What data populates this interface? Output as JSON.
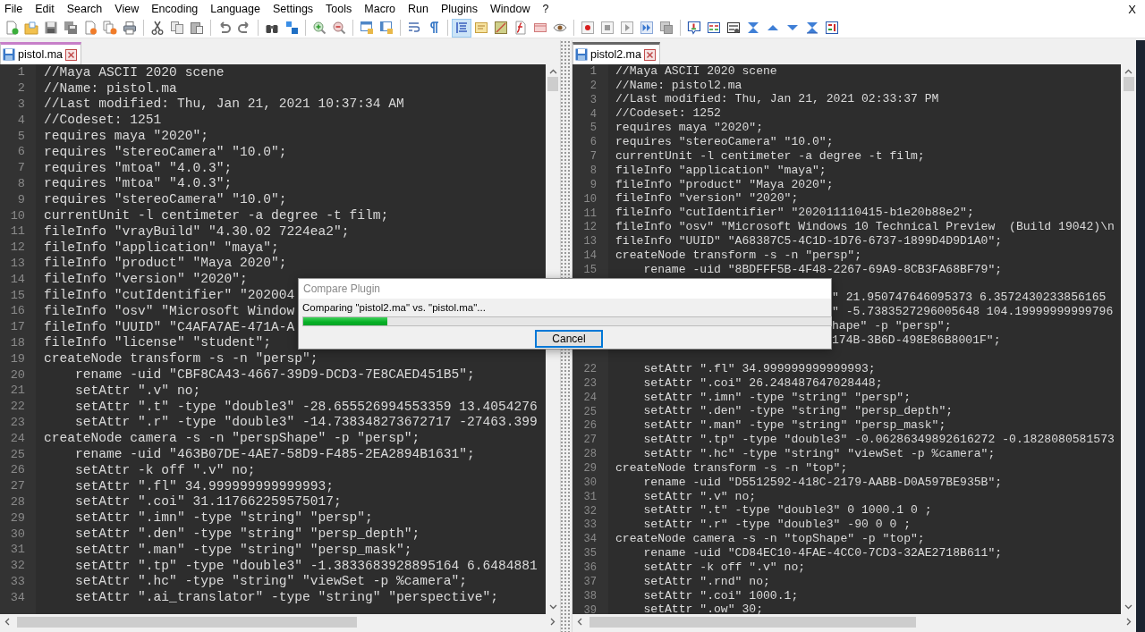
{
  "menu": [
    "File",
    "Edit",
    "Search",
    "View",
    "Encoding",
    "Language",
    "Settings",
    "Tools",
    "Macro",
    "Run",
    "Plugins",
    "Window",
    "?"
  ],
  "close_label": "X",
  "toolbar": [
    [
      {
        "kind": "new",
        "selected": false
      },
      {
        "kind": "open",
        "selected": false
      },
      {
        "kind": "save",
        "selected": false
      },
      {
        "kind": "save_all",
        "selected": false
      },
      {
        "kind": "close",
        "selected": false
      },
      {
        "kind": "close_all",
        "selected": false
      },
      {
        "kind": "print",
        "selected": false
      }
    ],
    [
      {
        "kind": "cut",
        "selected": false
      },
      {
        "kind": "copy",
        "selected": false
      },
      {
        "kind": "paste",
        "selected": false
      }
    ],
    [
      {
        "kind": "undo",
        "selected": false
      },
      {
        "kind": "redo",
        "selected": false
      }
    ],
    [
      {
        "kind": "find",
        "selected": false
      },
      {
        "kind": "replace",
        "selected": false
      }
    ],
    [
      {
        "kind": "zoom_in",
        "selected": false
      },
      {
        "kind": "zoom_out",
        "selected": false
      }
    ],
    [
      {
        "kind": "sync_v",
        "selected": false
      },
      {
        "kind": "sync_h",
        "selected": false
      }
    ],
    [
      {
        "kind": "wrap",
        "selected": false
      },
      {
        "kind": "all_chars",
        "selected": false
      }
    ],
    [
      {
        "kind": "indent_guide",
        "selected": true
      },
      {
        "kind": "note",
        "selected": false
      },
      {
        "kind": "map",
        "selected": false
      },
      {
        "kind": "function_list",
        "selected": false
      },
      {
        "kind": "panel",
        "selected": false
      },
      {
        "kind": "eye",
        "selected": false
      }
    ],
    [
      {
        "kind": "record",
        "selected": false
      },
      {
        "kind": "stop",
        "selected": false
      },
      {
        "kind": "play",
        "selected": false
      },
      {
        "kind": "play_multi",
        "selected": false
      },
      {
        "kind": "save_macro",
        "selected": false
      }
    ],
    [
      {
        "kind": "compare",
        "selected": false
      },
      {
        "kind": "compare_list",
        "selected": false
      },
      {
        "kind": "clear_compare",
        "selected": false
      },
      {
        "kind": "first",
        "selected": false
      },
      {
        "kind": "prev",
        "selected": false
      },
      {
        "kind": "next",
        "selected": false
      },
      {
        "kind": "last",
        "selected": false
      },
      {
        "kind": "nav_bar",
        "selected": false
      }
    ]
  ],
  "panes": [
    {
      "tab": {
        "label": "pistol.ma",
        "focused": true
      },
      "lines": [
        {
          "number": "1",
          "text": "//Maya ASCII 2020 scene"
        },
        {
          "number": "2",
          "text": "//Name: pistol.ma"
        },
        {
          "number": "3",
          "text": "//Last modified: Thu, Jan 21, 2021 10:37:34 AM"
        },
        {
          "number": "4",
          "text": "//Codeset: 1251"
        },
        {
          "number": "5",
          "text": "requires maya \"2020\";"
        },
        {
          "number": "6",
          "text": "requires \"stereoCamera\" \"10.0\";"
        },
        {
          "number": "7",
          "text": "requires \"mtoa\" \"4.0.3\";"
        },
        {
          "number": "8",
          "text": "requires \"mtoa\" \"4.0.3\";"
        },
        {
          "number": "9",
          "text": "requires \"stereoCamera\" \"10.0\";"
        },
        {
          "number": "10",
          "text": "currentUnit -l centimeter -a degree -t film;"
        },
        {
          "number": "11",
          "text": "fileInfo \"vrayBuild\" \"4.30.02 7224ea2\";"
        },
        {
          "number": "12",
          "text": "fileInfo \"application\" \"maya\";"
        },
        {
          "number": "13",
          "text": "fileInfo \"product\" \"Maya 2020\";"
        },
        {
          "number": "14",
          "text": "fileInfo \"version\" \"2020\";"
        },
        {
          "number": "15",
          "text": "fileInfo \"cutIdentifier\" \"202004"
        },
        {
          "number": "16",
          "text": "fileInfo \"osv\" \"Microsoft Window"
        },
        {
          "number": "17",
          "text": "fileInfo \"UUID\" \"C4AFA7AE-471A-A"
        },
        {
          "number": "18",
          "text": "fileInfo \"license\" \"student\";"
        },
        {
          "number": "19",
          "text": "createNode transform -s -n \"persp\";"
        },
        {
          "number": "20",
          "text": "    rename -uid \"CBF8CA43-4667-39D9-DCD3-7E8CAED451B5\";"
        },
        {
          "number": "21",
          "text": "    setAttr \".v\" no;"
        },
        {
          "number": "22",
          "text": "    setAttr \".t\" -type \"double3\" -28.655526994553359 13.4054276"
        },
        {
          "number": "23",
          "text": "    setAttr \".r\" -type \"double3\" -14.738348273672717 -27463.399"
        },
        {
          "number": "24",
          "text": "createNode camera -s -n \"perspShape\" -p \"persp\";"
        },
        {
          "number": "25",
          "text": "    rename -uid \"463B07DE-4AE7-58D9-F485-2EA2894B1631\";"
        },
        {
          "number": "26",
          "text": "    setAttr -k off \".v\" no;"
        },
        {
          "number": "27",
          "text": "    setAttr \".fl\" 34.999999999999993;"
        },
        {
          "number": "28",
          "text": "    setAttr \".coi\" 31.117662259575017;"
        },
        {
          "number": "29",
          "text": "    setAttr \".imn\" -type \"string\" \"persp\";"
        },
        {
          "number": "30",
          "text": "    setAttr \".den\" -type \"string\" \"persp_depth\";"
        },
        {
          "number": "31",
          "text": "    setAttr \".man\" -type \"string\" \"persp_mask\";"
        },
        {
          "number": "32",
          "text": "    setAttr \".tp\" -type \"double3\" -1.3833683928895164 6.6484881"
        },
        {
          "number": "33",
          "text": "    setAttr \".hc\" -type \"string\" \"viewSet -p %camera\";"
        },
        {
          "number": "34",
          "text": "    setAttr \".ai_translator\" -type \"string\" \"perspective\";"
        }
      ]
    },
    {
      "tab": {
        "label": "pistol2.ma",
        "focused": false
      },
      "lines": [
        {
          "number": "1",
          "text": "//Maya ASCII 2020 scene"
        },
        {
          "number": "2",
          "text": "//Name: pistol2.ma"
        },
        {
          "number": "3",
          "text": "//Last modified: Thu, Jan 21, 2021 02:33:37 PM"
        },
        {
          "number": "4",
          "text": "//Codeset: 1252"
        },
        {
          "number": "5",
          "text": "requires maya \"2020\";"
        },
        {
          "number": "6",
          "text": "requires \"stereoCamera\" \"10.0\";"
        },
        {
          "number": "7",
          "text": "currentUnit -l centimeter -a degree -t film;"
        },
        {
          "number": "8",
          "text": "fileInfo \"application\" \"maya\";"
        },
        {
          "number": "9",
          "text": "fileInfo \"product\" \"Maya 2020\";"
        },
        {
          "number": "10",
          "text": "fileInfo \"version\" \"2020\";"
        },
        {
          "number": "11",
          "text": "fileInfo \"cutIdentifier\" \"202011110415-b1e20b88e2\";"
        },
        {
          "number": "12",
          "text": "fileInfo \"osv\" \"Microsoft Windows 10 Technical Preview  (Build 19042)\\n"
        },
        {
          "number": "13",
          "text": "fileInfo \"UUID\" \"A68387C5-4C1D-1D76-6737-1899D4D9D1A0\";"
        },
        {
          "number": "14",
          "text": "createNode transform -s -n \"persp\";"
        },
        {
          "number": "15",
          "text": "    rename -uid \"8BDFFF5B-4F48-2267-69A9-8CB3FA68BF79\";"
        },
        {
          "kind": "covered"
        },
        {
          "kind": "tail",
          "text": "\" 21.950747646095373 6.3572430233856165"
        },
        {
          "kind": "tail",
          "text": "\" -5.7383527296005648 104.19999999999796"
        },
        {
          "kind": "tail",
          "text": "hape\" -p \"persp\";"
        },
        {
          "kind": "tail",
          "text": "174B-3B6D-498E86B8001F\";"
        },
        {
          "kind": "covered"
        },
        {
          "number": "22",
          "text": "    setAttr \".fl\" 34.999999999999993;"
        },
        {
          "number": "23",
          "text": "    setAttr \".coi\" 26.248487647028448;"
        },
        {
          "number": "24",
          "text": "    setAttr \".imn\" -type \"string\" \"persp\";"
        },
        {
          "number": "25",
          "text": "    setAttr \".den\" -type \"string\" \"persp_depth\";"
        },
        {
          "number": "26",
          "text": "    setAttr \".man\" -type \"string\" \"persp_mask\";"
        },
        {
          "number": "27",
          "text": "    setAttr \".tp\" -type \"double3\" -0.06286349892616272 -0.1828080581573"
        },
        {
          "number": "28",
          "text": "    setAttr \".hc\" -type \"string\" \"viewSet -p %camera\";"
        },
        {
          "number": "29",
          "text": "createNode transform -s -n \"top\";"
        },
        {
          "number": "30",
          "text": "    rename -uid \"D5512592-418C-2179-AABB-D0A597BE935B\";"
        },
        {
          "number": "31",
          "text": "    setAttr \".v\" no;"
        },
        {
          "number": "32",
          "text": "    setAttr \".t\" -type \"double3\" 0 1000.1 0 ;"
        },
        {
          "number": "33",
          "text": "    setAttr \".r\" -type \"double3\" -90 0 0 ;"
        },
        {
          "number": "34",
          "text": "createNode camera -s -n \"topShape\" -p \"top\";"
        },
        {
          "number": "35",
          "text": "    rename -uid \"CD84EC10-4FAE-4CC0-7CD3-32AE2718B611\";"
        },
        {
          "number": "36",
          "text": "    setAttr -k off \".v\" no;"
        },
        {
          "number": "37",
          "text": "    setAttr \".rnd\" no;"
        },
        {
          "number": "38",
          "text": "    setAttr \".coi\" 1000.1;"
        },
        {
          "number": "39",
          "text": "    setAttr \".ow\" 30;"
        }
      ]
    }
  ],
  "dialog": {
    "title": "Compare Plugin",
    "message": "Comparing \"pistol2.ma\" vs. \"pistol.ma\"...",
    "level": 0.16,
    "button": "Cancel"
  }
}
